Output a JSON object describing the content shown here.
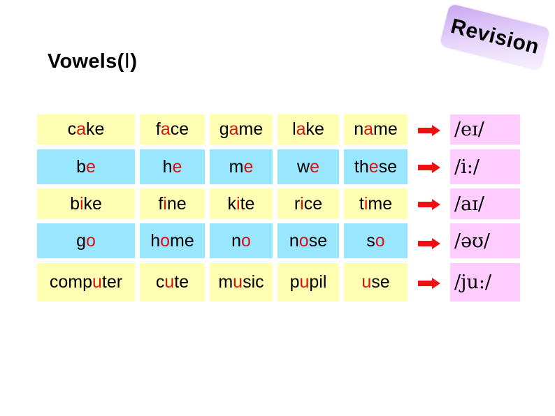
{
  "title": {
    "text": "Vowels(",
    "roman": "Ⅰ",
    "close": ")"
  },
  "badge": {
    "label": "Revision"
  },
  "colors": {
    "yellow": "#ffffb4",
    "blue": "#99e6ff",
    "pink": "#ffccff",
    "highlight": "#dd1111",
    "arrow": "#ee1111"
  },
  "rows": [
    {
      "color": "yellow",
      "phonetic": "/eɪ/",
      "words": [
        {
          "pre": "c",
          "hl": "a",
          "post": "ke"
        },
        {
          "pre": "f",
          "hl": "a",
          "post": "ce"
        },
        {
          "pre": "g",
          "hl": "a",
          "post": "me"
        },
        {
          "pre": "l",
          "hl": "a",
          "post": "ke"
        },
        {
          "pre": "n",
          "hl": "a",
          "post": "me"
        }
      ]
    },
    {
      "color": "blue",
      "phonetic": "/i:/",
      "words": [
        {
          "pre": "b",
          "hl": "e",
          "post": ""
        },
        {
          "pre": "h",
          "hl": "e",
          "post": ""
        },
        {
          "pre": "m",
          "hl": "e",
          "post": ""
        },
        {
          "pre": "w",
          "hl": "e",
          "post": ""
        },
        {
          "pre": "th",
          "hl": "e",
          "post": "se"
        }
      ]
    },
    {
      "color": "yellow",
      "phonetic": "/aɪ/",
      "words": [
        {
          "pre": "b",
          "hl": "i",
          "post": "ke"
        },
        {
          "pre": "f",
          "hl": "i",
          "post": "ne"
        },
        {
          "pre": "k",
          "hl": "i",
          "post": "te"
        },
        {
          "pre": "r",
          "hl": "i",
          "post": "ce"
        },
        {
          "pre": "t",
          "hl": "i",
          "post": "me"
        }
      ]
    },
    {
      "color": "blue",
      "phonetic": "/əʊ/",
      "words": [
        {
          "pre": "g",
          "hl": "o",
          "post": ""
        },
        {
          "pre": "h",
          "hl": "o",
          "post": "me"
        },
        {
          "pre": "n",
          "hl": "o",
          "post": ""
        },
        {
          "pre": "n",
          "hl": "o",
          "post": "se"
        },
        {
          "pre": "s",
          "hl": "o",
          "post": ""
        }
      ]
    },
    {
      "color": "yellow",
      "phonetic": "/ju:/",
      "words": [
        {
          "pre": "comp",
          "hl": "u",
          "post": "ter"
        },
        {
          "pre": "c",
          "hl": "u",
          "post": "te"
        },
        {
          "pre": "m",
          "hl": "u",
          "post": "sic"
        },
        {
          "pre": "p",
          "hl": "u",
          "post": "pil"
        },
        {
          "pre": "",
          "hl": "u",
          "post": "se"
        }
      ]
    }
  ]
}
